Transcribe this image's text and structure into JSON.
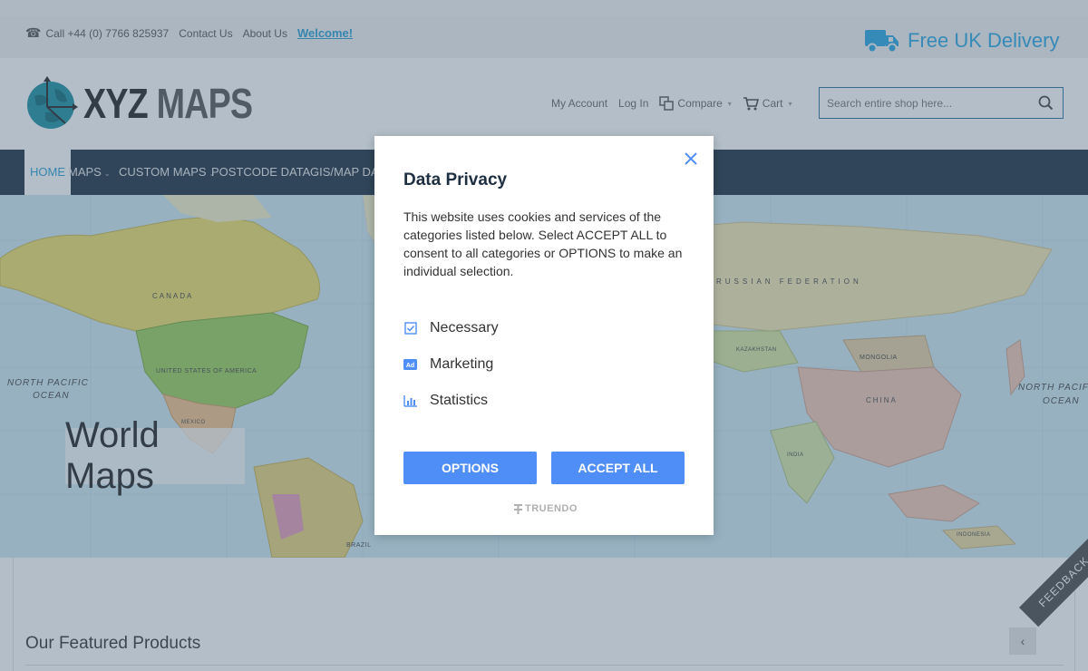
{
  "topbar": {
    "phone": "Call +44 (0) 7766 825937",
    "contact": "Contact Us",
    "about": "About Us",
    "welcome": "Welcome!",
    "delivery": "Free UK Delivery"
  },
  "header": {
    "logo_xyz": "XYZ",
    "logo_maps": "MAPS",
    "my_account": "My Account",
    "login": "Log In",
    "compare": "Compare",
    "cart": "Cart",
    "search_placeholder": "Search entire shop here..."
  },
  "nav": {
    "items": [
      {
        "label": "HOME",
        "active": true
      },
      {
        "label": "MAPS"
      },
      {
        "label": "CUSTOM MAPS"
      },
      {
        "label": "POSTCODE DATA"
      },
      {
        "label": "GIS/MAP DATA"
      }
    ]
  },
  "hero": {
    "label": "World Maps",
    "map_labels": [
      "CANADA",
      "UNITED STATES OF AMERICA",
      "NORTH PACIFIC",
      "OCEAN",
      "RUSSIAN FEDERATION",
      "KAZAKHSTAN",
      "MONGOLIA",
      "CHINA",
      "INDIA",
      "NORTH PACIFIC",
      "OCEAN",
      "BRAZIL",
      "MEXICO",
      "INDONESIA"
    ]
  },
  "featured": {
    "title": "Our Featured Products"
  },
  "feedback": "FEEDBACK",
  "modal": {
    "title": "Data Privacy",
    "body": "This website uses cookies and services of the categories listed below. Select ACCEPT ALL to consent to all categories or OPTIONS to make an individual selection.",
    "categories": [
      {
        "label": "Necessary",
        "icon": "checkbox-icon"
      },
      {
        "label": "Marketing",
        "icon": "ad-icon"
      },
      {
        "label": "Statistics",
        "icon": "bar-chart-icon"
      }
    ],
    "options_label": "OPTIONS",
    "accept_label": "ACCEPT ALL",
    "powered_by": "TRUENDO"
  },
  "colors": {
    "accent": "#4f8ef7",
    "nav_bg": "#1e2f42",
    "link": "#2a9fd6"
  }
}
